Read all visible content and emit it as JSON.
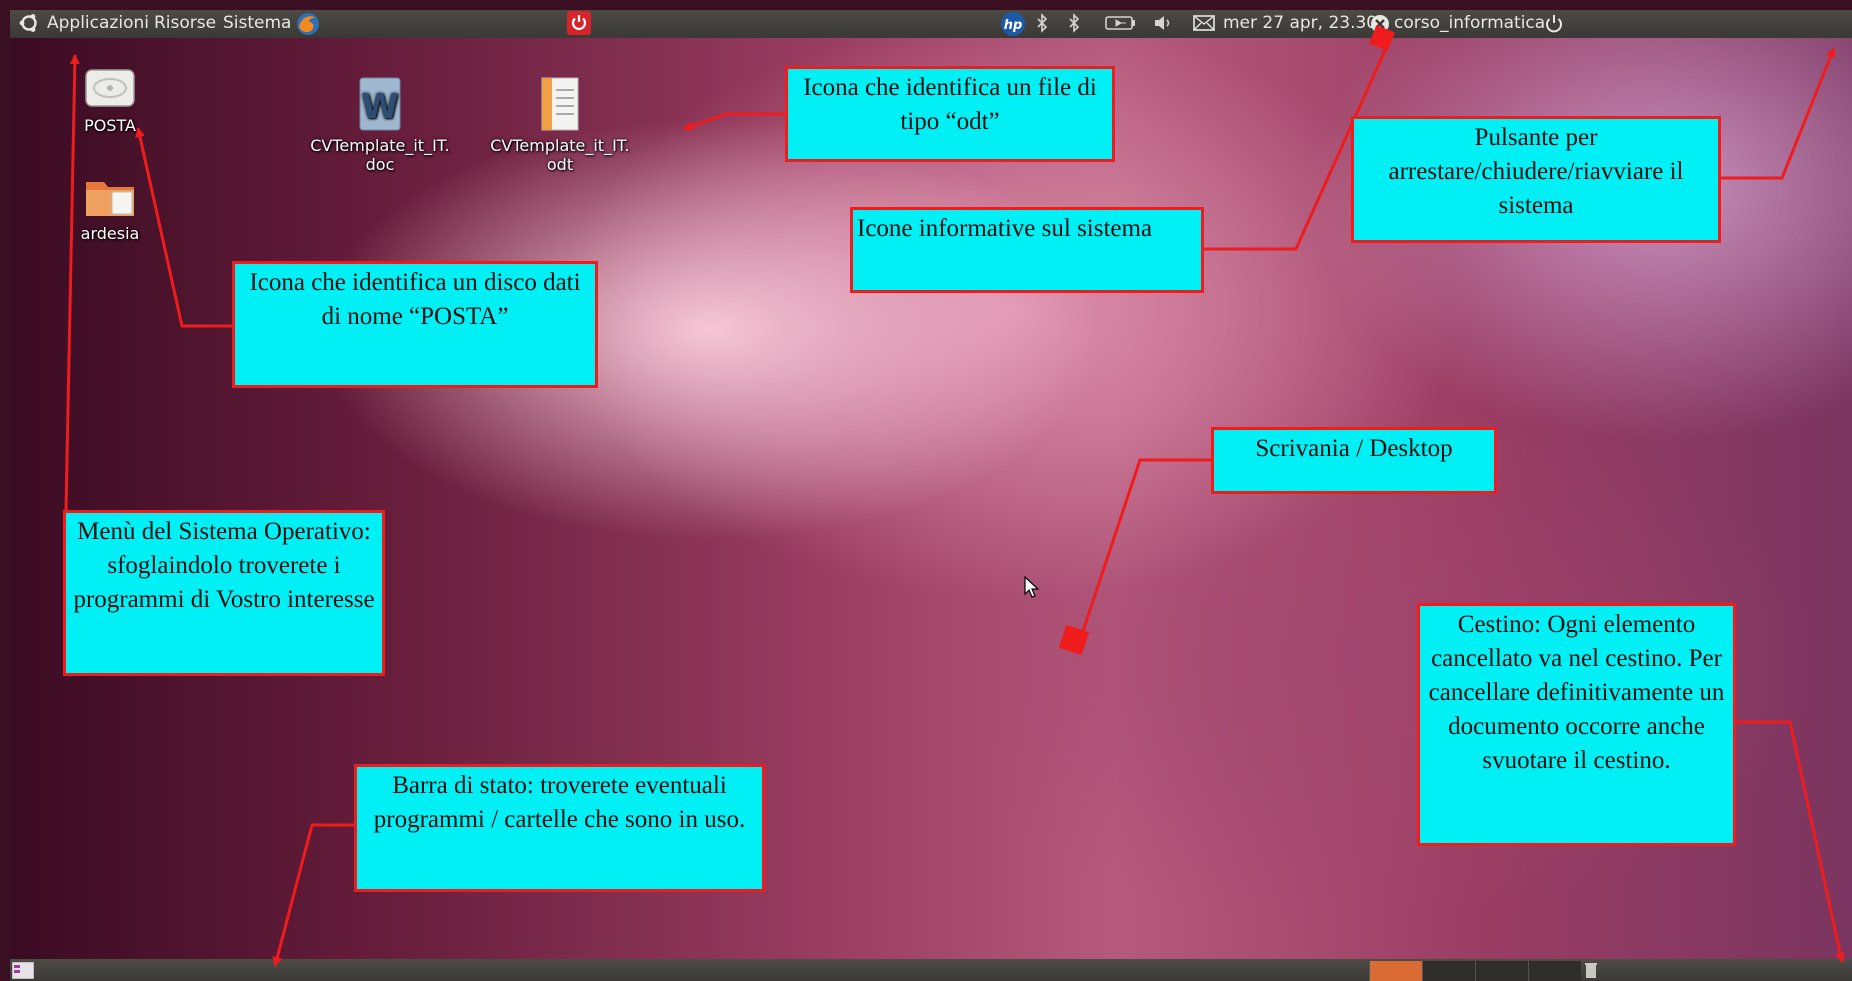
{
  "top_panel": {
    "menus": [
      "Applicazioni",
      "Risorse",
      "Sistema"
    ],
    "datetime": "mer 27 apr, 23.30",
    "user": "corso_informatica",
    "hp_label": "hp"
  },
  "desktop": {
    "icons": [
      {
        "label": "POSTA",
        "icon": "drive-icon"
      },
      {
        "label": "ardesia",
        "icon": "folder-icon"
      },
      {
        "label_line1": "CVTemplate_it_IT.",
        "label_line2": "doc",
        "icon": "word-doc-icon"
      },
      {
        "label_line1": "CVTemplate_it_IT.",
        "label_line2": "odt",
        "icon": "odt-doc-icon"
      }
    ]
  },
  "callouts": {
    "odt": "Icona che identifica un file di tipo “odt”",
    "system_info": "Icone informative sul sistema",
    "shutdown": "Pulsante per arrestare/chiudere/riavviare il sistema",
    "disk": "Icona che identifica un disco dati di nome “POSTA”",
    "desktop": "Scrivania / Desktop",
    "menu": "Menù del Sistema Operativo: sfoglaindolo troverete i programmi di Vostro interesse",
    "trash": "Cestino: Ogni elemento cancellato va nel cestino. Per cancellare definitivamente un documento occorre anche svuotare il cestino.",
    "status_bar": "Barra di stato: troverete eventuali programmi / cartelle che sono in uso."
  },
  "colors": {
    "callout_bg": "#00f0f5",
    "callout_border": "#ee1c1c",
    "arrow": "#ee1c1c"
  }
}
